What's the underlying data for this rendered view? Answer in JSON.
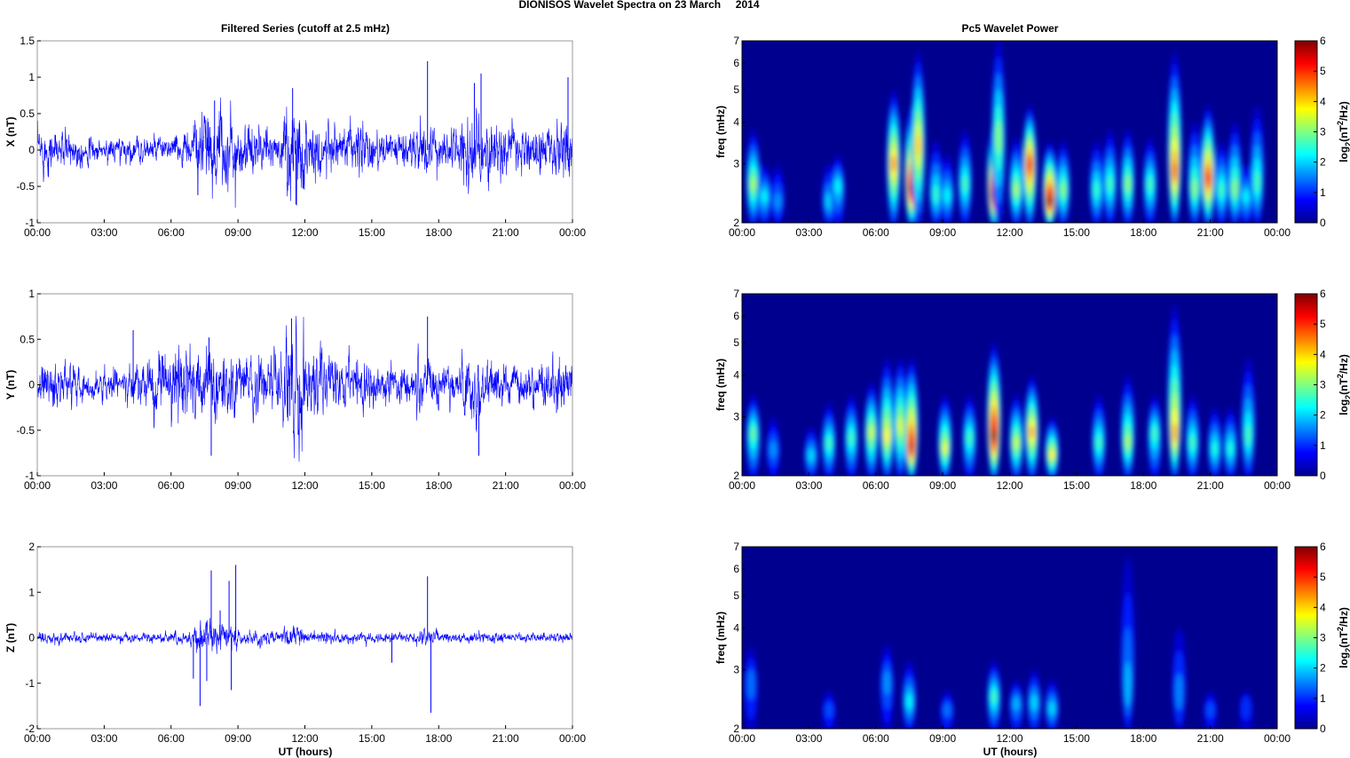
{
  "chart_data": {
    "title": "DIONISOS Wavelet Spectra on 23 March     2014",
    "left_title": "Filtered Series (cutoff at 2.5 mHz)",
    "right_title": "Pc5 Wavelet Power",
    "xlabel": "UT (hours)",
    "xlim": [
      0,
      24
    ],
    "xticks": [
      "00:00",
      "03:00",
      "06:00",
      "09:00",
      "12:00",
      "15:00",
      "18:00",
      "21:00",
      "00:00"
    ],
    "series_color": "#0000ff",
    "series": [
      {
        "type": "line",
        "name": "X",
        "ylabel": "X (nT)",
        "ylim": [
          -1,
          1.5
        ],
        "yticks": [
          "1.5",
          "1",
          "0.5",
          "0",
          "-0.5",
          "-1"
        ],
        "ytick_values": [
          1.5,
          1,
          0.5,
          0,
          -0.5,
          -1
        ],
        "amplitude_by_hour": [
          0.22,
          0.18,
          0.12,
          0.12,
          0.12,
          0.12,
          0.15,
          0.35,
          0.4,
          0.25,
          0.18,
          0.45,
          0.3,
          0.25,
          0.25,
          0.18,
          0.2,
          0.25,
          0.2,
          0.35,
          0.3,
          0.22,
          0.22,
          0.3
        ],
        "spikes": [
          [
            17.5,
            1.22
          ],
          [
            11.45,
            0.85
          ],
          [
            11.6,
            -0.75
          ],
          [
            19.9,
            1.05
          ],
          [
            19.6,
            0.92
          ],
          [
            7.95,
            0.68
          ],
          [
            7.2,
            -0.62
          ],
          [
            23.8,
            1.0
          ]
        ]
      },
      {
        "type": "line",
        "name": "Y",
        "ylabel": "Y (nT)",
        "ylim": [
          -1,
          1
        ],
        "yticks": [
          "1",
          "0.5",
          "0",
          "-0.5",
          "-1"
        ],
        "ytick_values": [
          1,
          0.5,
          0,
          -0.5,
          -1
        ],
        "amplitude_by_hour": [
          0.18,
          0.15,
          0.12,
          0.12,
          0.15,
          0.25,
          0.28,
          0.3,
          0.25,
          0.2,
          0.18,
          0.4,
          0.25,
          0.22,
          0.2,
          0.15,
          0.15,
          0.2,
          0.15,
          0.25,
          0.2,
          0.15,
          0.18,
          0.22
        ],
        "spikes": [
          [
            11.4,
            0.73
          ],
          [
            17.5,
            0.75
          ],
          [
            7.8,
            -0.78
          ],
          [
            19.8,
            -0.78
          ],
          [
            11.7,
            -0.55
          ],
          [
            4.3,
            0.6
          ],
          [
            7.7,
            0.52
          ]
        ]
      },
      {
        "type": "line",
        "name": "Z",
        "ylabel": "Z (nT)",
        "ylim": [
          -2,
          2
        ],
        "yticks": [
          "2",
          "1",
          "0",
          "-1",
          "-2"
        ],
        "ytick_values": [
          2,
          1,
          0,
          -1,
          -2
        ],
        "amplitude_by_hour": [
          0.1,
          0.08,
          0.07,
          0.07,
          0.07,
          0.08,
          0.1,
          0.25,
          0.2,
          0.12,
          0.1,
          0.15,
          0.1,
          0.08,
          0.08,
          0.08,
          0.08,
          0.12,
          0.08,
          0.08,
          0.08,
          0.07,
          0.07,
          0.08
        ],
        "spikes": [
          [
            7.8,
            1.48
          ],
          [
            7.3,
            -1.5
          ],
          [
            8.9,
            1.6
          ],
          [
            8.6,
            1.25
          ],
          [
            7.0,
            -0.9
          ],
          [
            7.6,
            -0.95
          ],
          [
            8.7,
            -1.15
          ],
          [
            17.5,
            1.35
          ],
          [
            17.65,
            -1.65
          ],
          [
            15.9,
            -0.55
          ],
          [
            8.2,
            0.6
          ]
        ]
      },
      {
        "type": "heatmap",
        "name": "X power",
        "ylabel": "freq (mHz)",
        "ylim": [
          2,
          7
        ],
        "yticks": [
          "7",
          "6",
          "5",
          "4",
          "3",
          "2"
        ],
        "ytick_values": [
          7,
          6,
          5,
          4,
          3,
          2
        ],
        "blobs": [
          [
            0.5,
            2.6,
            3.2,
            3.8
          ],
          [
            1.0,
            2.4,
            2.2,
            3.0
          ],
          [
            1.6,
            2.3,
            1.6,
            3.0
          ],
          [
            3.9,
            2.3,
            2.0,
            3.0
          ],
          [
            4.3,
            2.6,
            2.2,
            3.2
          ],
          [
            6.8,
            3.0,
            4.3,
            5.0
          ],
          [
            7.6,
            2.5,
            5.6,
            4.5
          ],
          [
            7.9,
            3.4,
            4.0,
            6.5
          ],
          [
            8.7,
            2.4,
            2.5,
            3.5
          ],
          [
            9.2,
            2.4,
            2.2,
            3.2
          ],
          [
            10.0,
            2.6,
            2.6,
            3.8
          ],
          [
            11.3,
            2.4,
            5.9,
            4.0
          ],
          [
            11.5,
            3.6,
            3.0,
            7.0
          ],
          [
            12.3,
            2.5,
            3.2,
            3.6
          ],
          [
            12.9,
            3.0,
            5.0,
            4.5
          ],
          [
            13.8,
            2.3,
            5.9,
            3.5
          ],
          [
            14.4,
            2.5,
            3.0,
            3.5
          ],
          [
            15.9,
            2.5,
            2.5,
            3.5
          ],
          [
            16.5,
            2.6,
            2.6,
            3.8
          ],
          [
            17.3,
            2.6,
            3.0,
            3.8
          ],
          [
            18.3,
            2.6,
            2.6,
            3.6
          ],
          [
            19.4,
            2.8,
            4.6,
            6.5
          ],
          [
            20.3,
            2.5,
            3.0,
            4.0
          ],
          [
            20.9,
            2.7,
            5.0,
            4.5
          ],
          [
            21.5,
            2.5,
            2.6,
            3.5
          ],
          [
            22.1,
            2.5,
            3.0,
            4.0
          ],
          [
            22.6,
            2.4,
            2.2,
            3.0
          ],
          [
            23.1,
            2.6,
            2.6,
            4.5
          ]
        ]
      },
      {
        "type": "heatmap",
        "name": "Y power",
        "ylabel": "freq (mHz)",
        "ylim": [
          2,
          7
        ],
        "yticks": [
          "7",
          "6",
          "5",
          "4",
          "3",
          "2"
        ],
        "ytick_values": [
          7,
          6,
          5,
          4,
          3,
          2
        ],
        "blobs": [
          [
            0.5,
            2.7,
            2.8,
            3.5
          ],
          [
            1.4,
            2.4,
            1.6,
            3.0
          ],
          [
            3.1,
            2.3,
            2.0,
            2.8
          ],
          [
            3.9,
            2.5,
            2.6,
            3.3
          ],
          [
            4.9,
            2.6,
            2.6,
            3.5
          ],
          [
            5.8,
            2.7,
            3.4,
            3.8
          ],
          [
            6.5,
            2.6,
            3.8,
            4.5
          ],
          [
            7.1,
            2.8,
            3.5,
            4.5
          ],
          [
            7.6,
            2.4,
            5.4,
            4.5
          ],
          [
            9.1,
            2.4,
            3.6,
            3.5
          ],
          [
            10.2,
            2.6,
            2.6,
            3.5
          ],
          [
            11.3,
            2.6,
            5.8,
            5.0
          ],
          [
            12.3,
            2.5,
            3.4,
            3.5
          ],
          [
            13.0,
            2.7,
            4.2,
            4.0
          ],
          [
            13.9,
            2.3,
            3.8,
            3.0
          ],
          [
            16.0,
            2.5,
            2.6,
            3.5
          ],
          [
            17.3,
            2.5,
            3.2,
            4.0
          ],
          [
            18.5,
            2.7,
            2.6,
            3.5
          ],
          [
            19.4,
            2.6,
            4.2,
            6.5
          ],
          [
            20.2,
            2.5,
            2.6,
            3.5
          ],
          [
            21.2,
            2.4,
            2.4,
            3.2
          ],
          [
            21.9,
            2.4,
            2.4,
            3.2
          ],
          [
            22.7,
            2.6,
            2.6,
            4.5
          ]
        ]
      },
      {
        "type": "heatmap",
        "name": "Z power",
        "ylabel": "freq (mHz)",
        "ylim": [
          2,
          7
        ],
        "yticks": [
          "7",
          "6",
          "5",
          "4",
          "3",
          "2"
        ],
        "ytick_values": [
          7,
          6,
          5,
          4,
          3,
          2
        ],
        "blobs": [
          [
            0.4,
            2.8,
            1.4,
            3.5
          ],
          [
            3.9,
            2.3,
            1.2,
            2.6
          ],
          [
            6.5,
            2.8,
            1.6,
            3.6
          ],
          [
            7.5,
            2.4,
            2.2,
            3.2
          ],
          [
            9.2,
            2.3,
            1.4,
            2.6
          ],
          [
            11.3,
            2.5,
            2.6,
            3.2
          ],
          [
            12.3,
            2.4,
            1.8,
            2.8
          ],
          [
            13.1,
            2.4,
            2.0,
            3.0
          ],
          [
            13.9,
            2.3,
            2.0,
            2.8
          ],
          [
            17.3,
            2.5,
            1.8,
            6.5
          ],
          [
            19.6,
            2.5,
            1.5,
            4.0
          ],
          [
            21.0,
            2.3,
            1.2,
            2.6
          ],
          [
            22.6,
            2.4,
            1.0,
            2.6
          ]
        ]
      }
    ],
    "colorbar": {
      "label_prefix": "log",
      "label_sub": "2",
      "label_mid": "(nT",
      "label_sup": "2",
      "label_suffix": "/Hz)",
      "range": [
        0,
        6
      ],
      "ticks": [
        "6",
        "5",
        "4",
        "3",
        "2",
        "1",
        "0"
      ],
      "tick_values": [
        6,
        5,
        4,
        3,
        2,
        1,
        0
      ],
      "colormap": "jet"
    }
  }
}
